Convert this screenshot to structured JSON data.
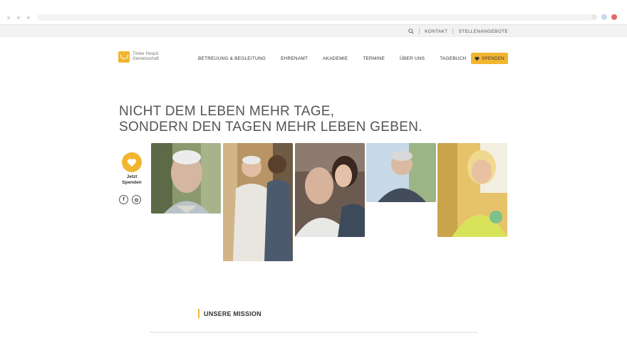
{
  "utility_bar": {
    "kontakt": "KONTAKT",
    "stellenangebote": "STELLENANGEBOTE"
  },
  "header": {
    "logo_line1": "Tiroler Hospiz",
    "logo_line2": "Gemeinschaft",
    "nav": [
      "BETREUUNG & BEGLEITUNG",
      "EHRENAMT",
      "AKADEMIE",
      "TERMINE",
      "ÜBER UNS",
      "TAGEBUCH"
    ],
    "donate_button": "SPENDEN"
  },
  "hero": {
    "line1": "NICHT DEM LEBEN MEHR TAGE,",
    "line2": "SONDERN DEN TAGEN MEHR LEBEN GEBEN."
  },
  "side_donate": {
    "line1": "Jetzt",
    "line2": "Spenden"
  },
  "social": {
    "facebook_glyph": "f",
    "instagram_glyph": "◎"
  },
  "mission_heading": "UNSERE MISSION",
  "colors": {
    "accent": "#f2b531",
    "text": "#333333",
    "utility_bg": "#f2f2f2"
  },
  "icons": [
    "search-icon",
    "heart-icon",
    "facebook-icon",
    "instagram-icon",
    "logo-mark-icon"
  ]
}
